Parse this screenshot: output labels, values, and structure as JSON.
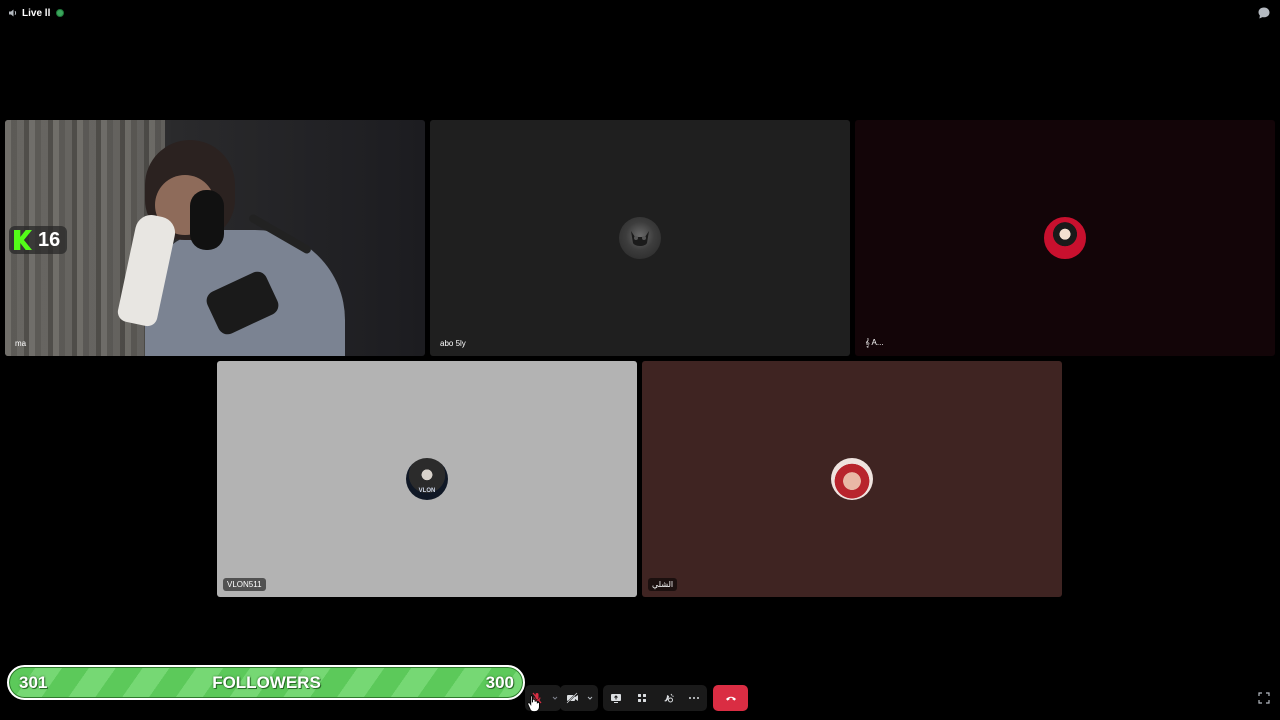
{
  "header": {
    "channel_label": "Live ll",
    "speaker_icon": "speaker-icon",
    "status_color": "#3ba55c",
    "chat_icon": "chat-bubble-icon"
  },
  "tiles": [
    {
      "name": "ma",
      "type": "video"
    },
    {
      "name": "abo 5ly",
      "type": "avatar",
      "avatar": "demon-avatar"
    },
    {
      "name": "𝄞 A...",
      "type": "avatar",
      "avatar": "red-cartoon-avatar"
    },
    {
      "name": "VLON511",
      "type": "avatar",
      "avatar": "vlon-avatar",
      "avatar_text": "VLON"
    },
    {
      "name": "الشلي",
      "type": "avatar",
      "avatar": "user-photo-avatar"
    }
  ],
  "overlay": {
    "kick_count": "16",
    "kick_color": "#53fc18"
  },
  "followers": {
    "current": "301",
    "label": "FOLLOWERS",
    "goal": "300",
    "progress": 1.0
  },
  "controls": {
    "mic_icon": "microphone-muted-icon",
    "camera_icon": "camera-off-icon",
    "screen_share_icon": "screen-share-icon",
    "activities_icon": "activities-icon",
    "soundboard_icon": "soundboard-icon",
    "more_icon": "more-icon",
    "end_call_icon": "phone-hangup-icon",
    "end_call_color": "#da2d43",
    "fullscreen_icon": "fullscreen-icon"
  }
}
